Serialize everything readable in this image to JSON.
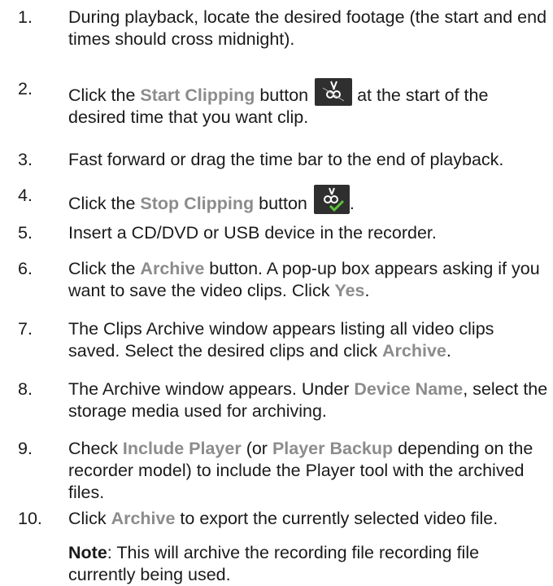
{
  "steps": [
    {
      "num": "1.",
      "text": "During playback, locate the desired footage (the start and end times should cross midnight)."
    },
    {
      "num": "2.",
      "pre": "Click the ",
      "hl": "Start Clipping",
      "mid": " button",
      "post": " at the start of the desired time that you want clip.",
      "icon": "start-clipping-icon"
    },
    {
      "num": "3.",
      "text": "Fast forward or drag the time bar to the end of playback."
    },
    {
      "num": "4.",
      "pre": "Click the ",
      "hl": "Stop Clipping",
      "mid": " button",
      "post": ".",
      "icon": "stop-clipping-icon"
    },
    {
      "num": "5.",
      "text": "Insert a CD/DVD or USB device in the recorder."
    },
    {
      "num": "6.",
      "pre": "Click the ",
      "hl": "Archive",
      "mid": " button. A pop-up box appears asking if you want to save the video clips. Click ",
      "hl2": "Yes",
      "post": "."
    },
    {
      "num": "7.",
      "pre": "The Clips Archive window appears listing all video clips saved. Select the desired clips and click ",
      "hl": "Archive",
      "post": "."
    },
    {
      "num": "8.",
      "pre": "The Archive window appears. Under ",
      "hl": "Device Name",
      "post": ", select the storage media used for archiving."
    },
    {
      "num": "9.",
      "pre": "Check ",
      "hl": "Include Player",
      "mid": " (or ",
      "hl2": "Player Backup",
      "post": " depending on the recorder model) to include the Player tool with the archived files."
    },
    {
      "num": "10.",
      "pre": "Click ",
      "hl": "Archive",
      "post": " to export the currently selected video file."
    }
  ],
  "note": {
    "label": "Note",
    "text": ": This will archive the recording file recording file currently being used."
  },
  "colors": {
    "highlight": "#8c8c8c",
    "icon_bg": "#2f2f2f",
    "check": "#5cc03a"
  }
}
